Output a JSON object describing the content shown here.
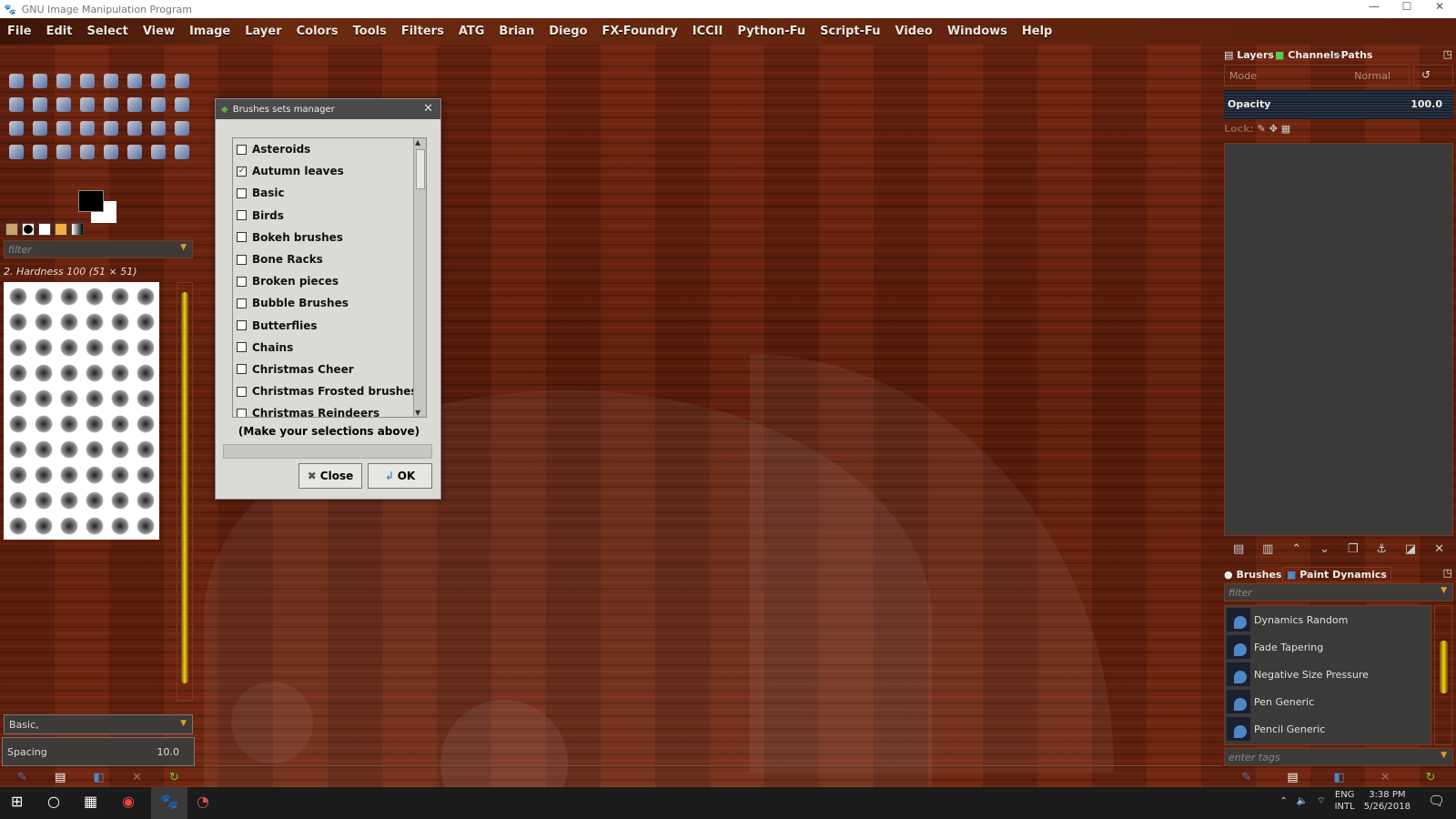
{
  "window": {
    "title": "GNU Image Manipulation Program",
    "controls": [
      "—",
      "☐",
      "✕"
    ]
  },
  "menu": [
    "File",
    "Edit",
    "Select",
    "View",
    "Image",
    "Layer",
    "Colors",
    "Tools",
    "Filters",
    "ATG",
    "Brian",
    "Diego",
    "FX-Foundry",
    "ICCII",
    "Python-Fu",
    "Script-Fu",
    "Video",
    "Windows",
    "Help"
  ],
  "left": {
    "filter_placeholder": "filter",
    "brush_name": "2. Hardness 100 (51 × 51)",
    "tag_value": "Basic,",
    "spacing_label": "Spacing",
    "spacing_value": "10.0"
  },
  "dialog": {
    "title": "Brushes sets manager",
    "items": [
      {
        "label": "Asteroids",
        "checked": false
      },
      {
        "label": "Autumn leaves",
        "checked": true
      },
      {
        "label": "Basic",
        "checked": false
      },
      {
        "label": "Birds",
        "checked": false
      },
      {
        "label": "Bokeh brushes",
        "checked": false
      },
      {
        "label": "Bone Racks",
        "checked": false
      },
      {
        "label": "Broken pieces",
        "checked": false
      },
      {
        "label": "Bubble Brushes",
        "checked": false
      },
      {
        "label": "Butterflies",
        "checked": false
      },
      {
        "label": "Chains",
        "checked": false
      },
      {
        "label": "Christmas Cheer",
        "checked": false
      },
      {
        "label": "Christmas Frosted brushes",
        "checked": false
      },
      {
        "label": "Christmas Reindeers",
        "checked": false
      }
    ],
    "hint": "(Make your selections above)",
    "close_label": "Close",
    "ok_label": "OK"
  },
  "right": {
    "tabs": [
      "Layers",
      "Channels",
      "Paths"
    ],
    "mode_label": "Mode",
    "mode_value": "Normal",
    "opacity_label": "Opacity",
    "opacity_value": "100.0",
    "lock_label": "Lock:",
    "bottom_tabs": [
      "Brushes",
      "Paint Dynamics"
    ],
    "filter_placeholder": "filter",
    "dynamics": [
      "Dynamics Random",
      "Fade Tapering",
      "Negative Size Pressure",
      "Pen Generic",
      "Pencil Generic"
    ],
    "tags_placeholder": "enter tags"
  },
  "taskbar": {
    "lang1": "ENG",
    "lang2": "INTL",
    "time": "3:38 PM",
    "date": "5/26/2018"
  }
}
